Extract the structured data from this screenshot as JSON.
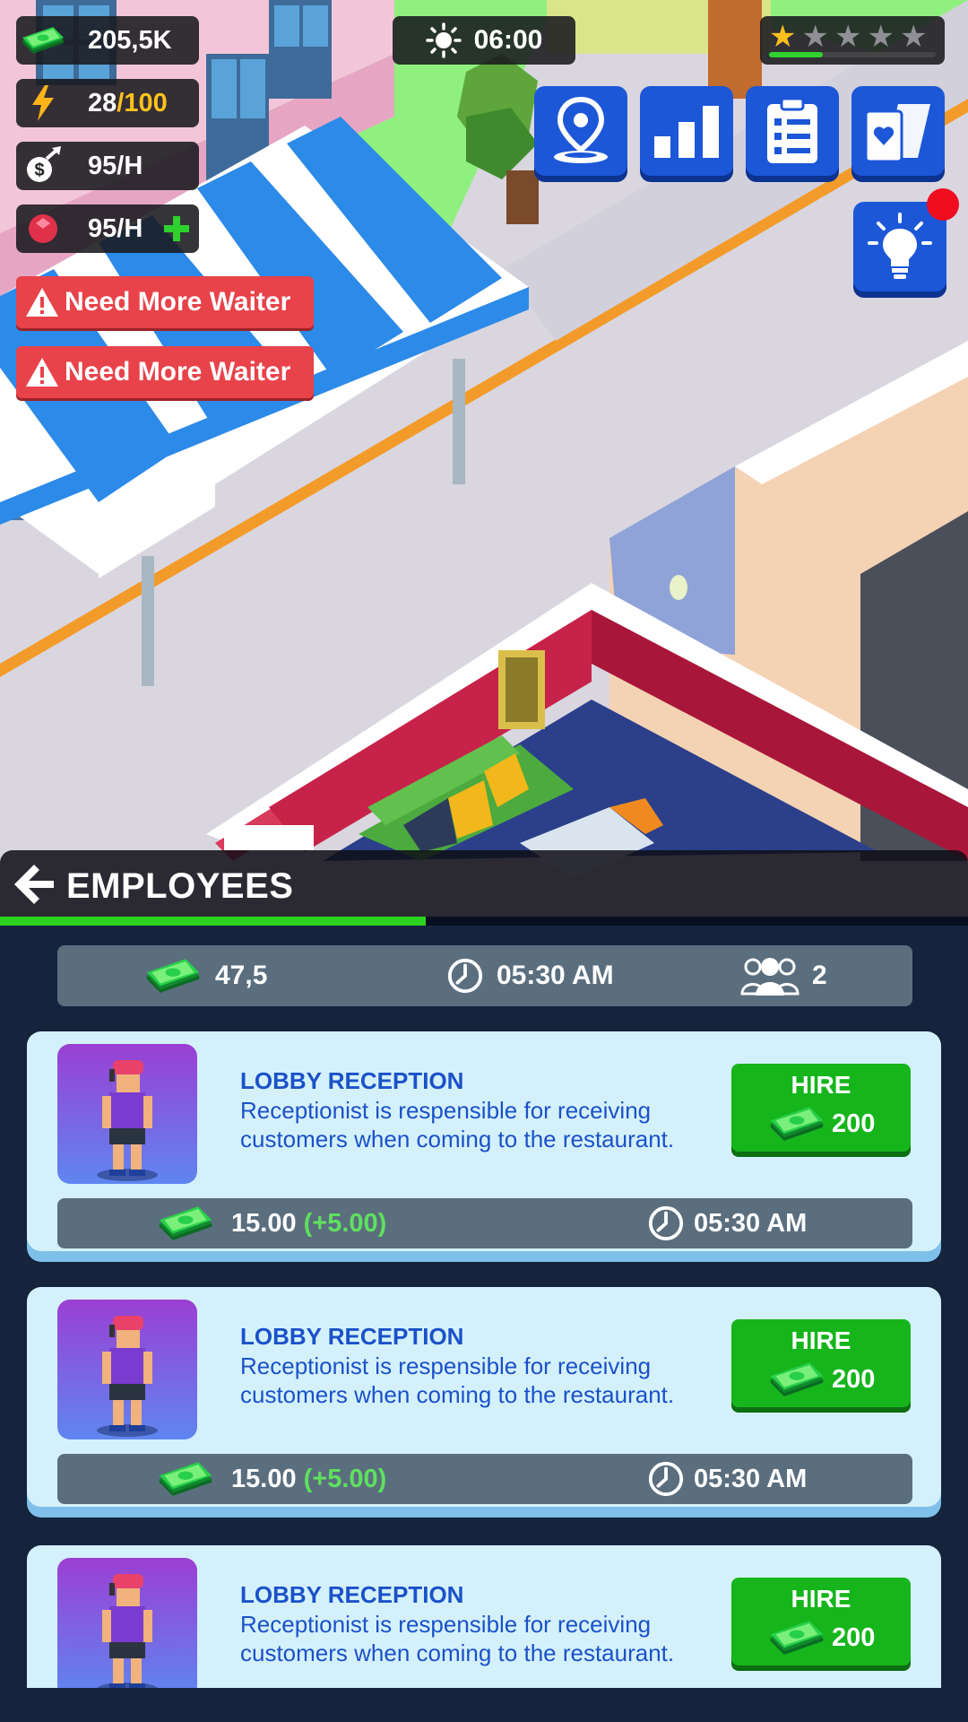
{
  "hud": {
    "money": "205,5K",
    "energy_current": "28",
    "energy_max": "/100",
    "income_rate": "95/H",
    "gem_rate": "95/H",
    "clock": "06:00",
    "rating_stars_filled": 1,
    "rating_stars_total": 5,
    "rating_progress": 0.32,
    "warnings": [
      "Need More Waiter",
      "Need More Waiter"
    ],
    "top_buttons": [
      "map-pin-icon",
      "bar-chart-icon",
      "clipboard-checklist-icon",
      "cards-heart-icon"
    ],
    "tip_button_icon": "lightbulb-icon",
    "has_notification": true
  },
  "panel": {
    "title": "EMPLOYEES",
    "progress": 0.44,
    "summary": {
      "money": "47,5",
      "time": "05:30 AM",
      "staff_count": "2"
    },
    "employees": [
      {
        "name": "LOBBY RECEPTION",
        "description": "Receptionist is respensible for receiving customers when coming to the restaurant.",
        "hire_label": "HIRE",
        "hire_cost": "200",
        "wage": "15.00",
        "wage_bonus": "(+5.00)",
        "shift_time": "05:30 AM"
      },
      {
        "name": "LOBBY RECEPTION",
        "description": "Receptionist is respensible for receiving customers when coming to the restaurant.",
        "hire_label": "HIRE",
        "hire_cost": "200",
        "wage": "15.00",
        "wage_bonus": "(+5.00)",
        "shift_time": "05:30 AM"
      },
      {
        "name": "LOBBY RECEPTION",
        "description": "Receptionist is respensible for receiving customers when coming to the restaurant.",
        "hire_label": "HIRE",
        "hire_cost": "200"
      }
    ]
  },
  "colors": {
    "accent_blue": "#1c57d8",
    "hire_green": "#16b51c",
    "warning_red": "#e8424a",
    "card_bg": "#d4f1fb",
    "panel_bg": "#15233d"
  }
}
